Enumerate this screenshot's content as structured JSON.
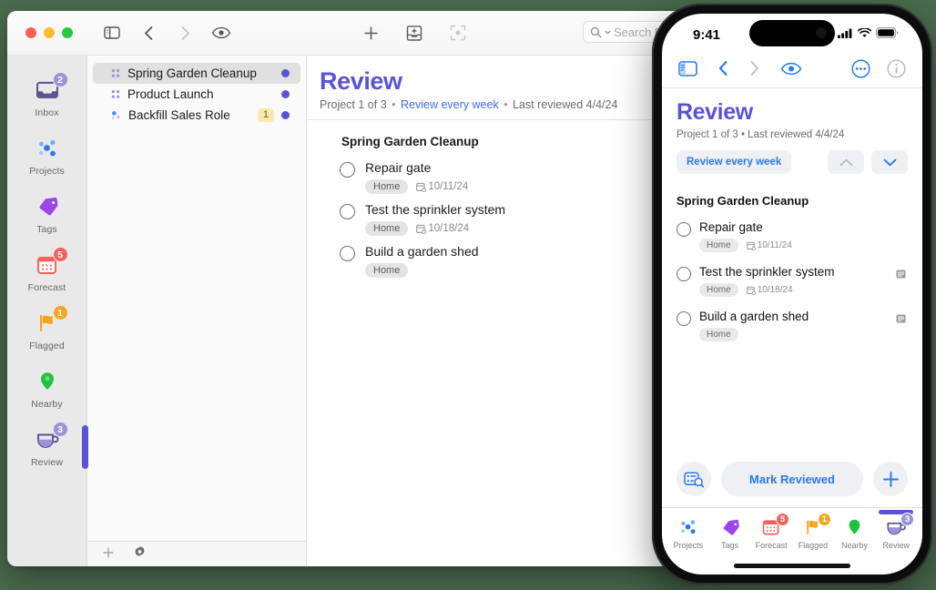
{
  "desktop": {
    "background_color": "#4a6b4d"
  },
  "mac": {
    "toolbar": {
      "sidebar_toggle": "sidebar-toggle-icon",
      "back": "back-chevron-icon",
      "forward": "forward-chevron-icon",
      "view": "eye-icon",
      "add": "plus-icon",
      "inbox_add": "inbox-add-icon",
      "focus": "focus-icon",
      "search_placeholder": "Search R"
    },
    "perspectives": [
      {
        "label": "Inbox",
        "icon": "inbox-icon",
        "badge": "2",
        "badge_color": "#9a93d8",
        "selected": false
      },
      {
        "label": "Projects",
        "icon": "projects-icon",
        "badge": "",
        "badge_color": "",
        "selected": false
      },
      {
        "label": "Tags",
        "icon": "tags-icon",
        "badge": "",
        "badge_color": "",
        "selected": false
      },
      {
        "label": "Forecast",
        "icon": "forecast-icon",
        "badge": "5",
        "badge_color": "#f4615f",
        "selected": false
      },
      {
        "label": "Flagged",
        "icon": "flag-icon",
        "badge": "1",
        "badge_color": "#f5a623",
        "selected": false
      },
      {
        "label": "Nearby",
        "icon": "pin-icon",
        "badge": "",
        "badge_color": "",
        "selected": false
      },
      {
        "label": "Review",
        "icon": "review-cup-icon",
        "badge": "3",
        "badge_color": "#9a93d8",
        "selected": true
      }
    ],
    "projects": [
      {
        "title": "Spring Garden Cleanup",
        "icon": "project-dots-icon",
        "count": "",
        "active": true
      },
      {
        "title": "Product Launch",
        "icon": "project-dots-icon",
        "count": "",
        "active": false
      },
      {
        "title": "Backfill Sales Role",
        "icon": "project-single-icon",
        "count": "1",
        "active": false
      }
    ],
    "project_footer": {
      "add": "plus-icon",
      "settings": "gear-icon"
    },
    "detail": {
      "title": "Review",
      "meta_position": "Project 1 of 3",
      "meta_repeat": "Review every week",
      "meta_reviewed": "Last reviewed 4/4/24",
      "separator": "•",
      "group_title": "Spring Garden Cleanup",
      "tasks": [
        {
          "name": "Repair gate",
          "tag": "Home",
          "date": "10/11/24",
          "has_note": false
        },
        {
          "name": "Test the sprinkler system",
          "tag": "Home",
          "date": "10/18/24",
          "has_note": false
        },
        {
          "name": "Build a garden shed",
          "tag": "Home",
          "date": "",
          "has_note": false
        }
      ]
    }
  },
  "phone": {
    "status": {
      "time": "9:41",
      "cellular": "signal-icon",
      "wifi": "wifi-icon",
      "battery": "battery-icon"
    },
    "navbar": {
      "sidebar": "sidebar-toggle-icon",
      "back": "back-chevron-icon",
      "forward": "forward-chevron-icon",
      "view": "eye-icon",
      "more": "ellipsis-circle-icon",
      "info": "info-circle-icon"
    },
    "detail": {
      "title": "Review",
      "meta": "Project 1 of 3 • Last reviewed 4/4/24",
      "repeat_pill": "Review every week",
      "prev": "chevron-up-icon",
      "next": "chevron-down-icon",
      "group_title": "Spring Garden Cleanup",
      "tasks": [
        {
          "name": "Repair gate",
          "tag": "Home",
          "date": "10/11/24",
          "has_note": false
        },
        {
          "name": "Test the sprinkler system",
          "tag": "Home",
          "date": "10/18/24",
          "has_note": true
        },
        {
          "name": "Build a garden shed",
          "tag": "Home",
          "date": "",
          "has_note": true
        }
      ]
    },
    "actions": {
      "inspect": "review-inspect-icon",
      "mark_reviewed": "Mark Reviewed",
      "add": "plus-icon"
    },
    "tabs": [
      {
        "label": "Projects",
        "icon": "projects-icon",
        "badge": "",
        "badge_color": "",
        "selected": false
      },
      {
        "label": "Tags",
        "icon": "tags-icon",
        "badge": "",
        "badge_color": "",
        "selected": false
      },
      {
        "label": "Forecast",
        "icon": "forecast-icon",
        "badge": "5",
        "badge_color": "#f4615f",
        "selected": false
      },
      {
        "label": "Flagged",
        "icon": "flag-icon",
        "badge": "1",
        "badge_color": "#f5a623",
        "selected": false
      },
      {
        "label": "Nearby",
        "icon": "pin-icon",
        "badge": "",
        "badge_color": "",
        "selected": false
      },
      {
        "label": "Review",
        "icon": "review-cup-icon",
        "badge": "3",
        "badge_color": "#9a93d8",
        "selected": true
      }
    ]
  }
}
